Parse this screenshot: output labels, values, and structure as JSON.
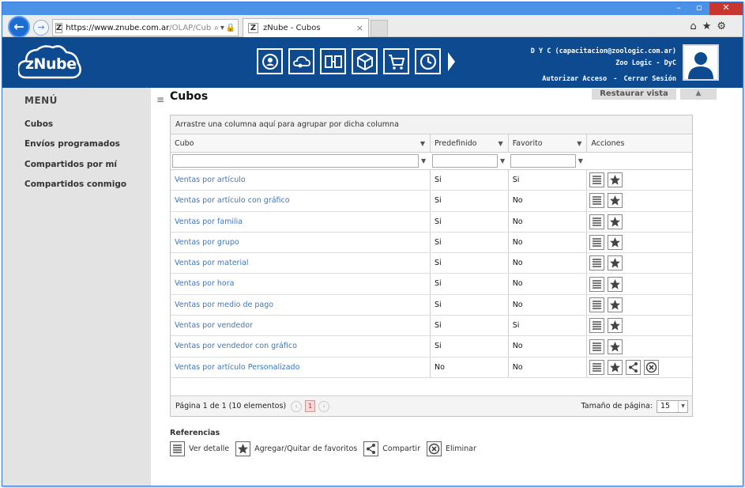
{
  "browser": {
    "url_host": "https://www.znube.com.ar",
    "url_path": "/OLAP/Cub",
    "tab_title": "zNube - Cubos",
    "favicon_letter": "Z"
  },
  "header": {
    "logo_text": "zNube",
    "modules": [
      "users-cycle-icon",
      "cloud-gear-icon",
      "tables-icon",
      "cube-icon",
      "cart-icon",
      "clock-icon"
    ],
    "user_line": "D Y C (capacitacion@zoologic.com.ar)",
    "company_line": "Zoo Logic - DyC",
    "link_authorize": "Autorizar Acceso",
    "link_separator": "-",
    "link_logout": "Cerrar Sesión"
  },
  "sidebar": {
    "title": "MENÚ",
    "items": [
      {
        "label": "Cubos"
      },
      {
        "label": "Envíos programados"
      },
      {
        "label": "Compartidos por mí"
      },
      {
        "label": "Compartidos conmigo"
      }
    ]
  },
  "content": {
    "title": "Cubos",
    "restore_label": "Restaurar vista"
  },
  "grid": {
    "group_hint": "Arrastre una columna aquí para agrupar por dicha columna",
    "columns": [
      "Cubo",
      "Predefinido",
      "Favorito",
      "Acciones"
    ],
    "rows": [
      {
        "cubo": "Ventas por artículo",
        "predefinido": "Si",
        "favorito": "Si",
        "extra": false
      },
      {
        "cubo": "Ventas por artículo con gráfico",
        "predefinido": "Si",
        "favorito": "No",
        "extra": false
      },
      {
        "cubo": "Ventas por familia",
        "predefinido": "Si",
        "favorito": "No",
        "extra": false
      },
      {
        "cubo": "Ventas por grupo",
        "predefinido": "Si",
        "favorito": "No",
        "extra": false
      },
      {
        "cubo": "Ventas por material",
        "predefinido": "Si",
        "favorito": "No",
        "extra": false
      },
      {
        "cubo": "Ventas por hora",
        "predefinido": "Si",
        "favorito": "No",
        "extra": false
      },
      {
        "cubo": "Ventas por medio de pago",
        "predefinido": "Si",
        "favorito": "No",
        "extra": false
      },
      {
        "cubo": "Ventas por vendedor",
        "predefinido": "Si",
        "favorito": "Si",
        "extra": false
      },
      {
        "cubo": "Ventas por vendedor con gráfico",
        "predefinido": "Si",
        "favorito": "No",
        "extra": false
      },
      {
        "cubo": "Ventas por artículo Personalizado",
        "predefinido": "No",
        "favorito": "No",
        "extra": true
      }
    ],
    "pager_text": "Página 1 de 1 (10 elementos)",
    "current_page": "1",
    "page_size_label": "Tamaño de página:",
    "page_size": "15"
  },
  "references": {
    "title": "Referencias",
    "items": [
      {
        "icon": "list-icon",
        "label": "Ver detalle"
      },
      {
        "icon": "star-icon",
        "label": "Agregar/Quitar de favoritos"
      },
      {
        "icon": "share-icon",
        "label": "Compartir"
      },
      {
        "icon": "delete-icon",
        "label": "Eliminar"
      }
    ]
  }
}
